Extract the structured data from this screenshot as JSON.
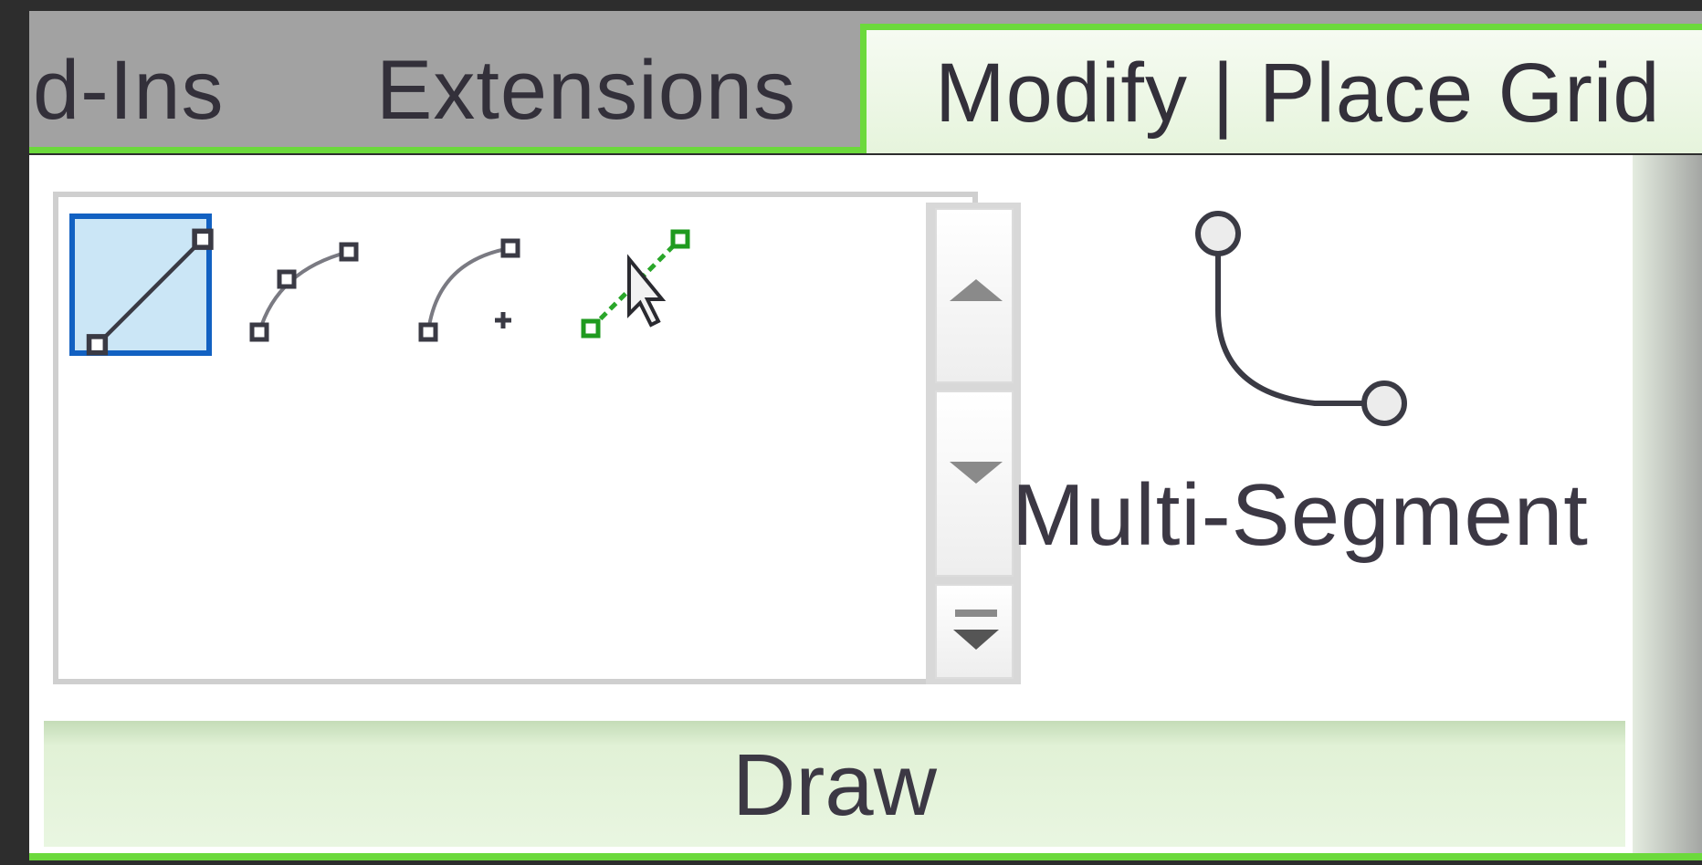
{
  "ribbon": {
    "tabs": [
      {
        "label": "d-Ins",
        "active": false
      },
      {
        "label": "Extensions",
        "active": false
      },
      {
        "label": "Modify | Place Grid",
        "active": true
      }
    ],
    "accent_color": "#6cd93c"
  },
  "draw_panel": {
    "title": "Draw",
    "tools": [
      {
        "icon": "line-icon",
        "selected": true
      },
      {
        "icon": "start-end-radius-arc-icon",
        "selected": false
      },
      {
        "icon": "center-ends-arc-icon",
        "selected": false
      },
      {
        "icon": "pick-lines-icon",
        "selected": false
      }
    ],
    "scroll": {
      "up_icon": "scroll-up-icon",
      "down_icon": "scroll-down-icon",
      "more_icon": "expand-gallery-icon"
    },
    "multi_segment": {
      "label": "Multi-Segment",
      "icon": "multi-segment-icon"
    }
  }
}
